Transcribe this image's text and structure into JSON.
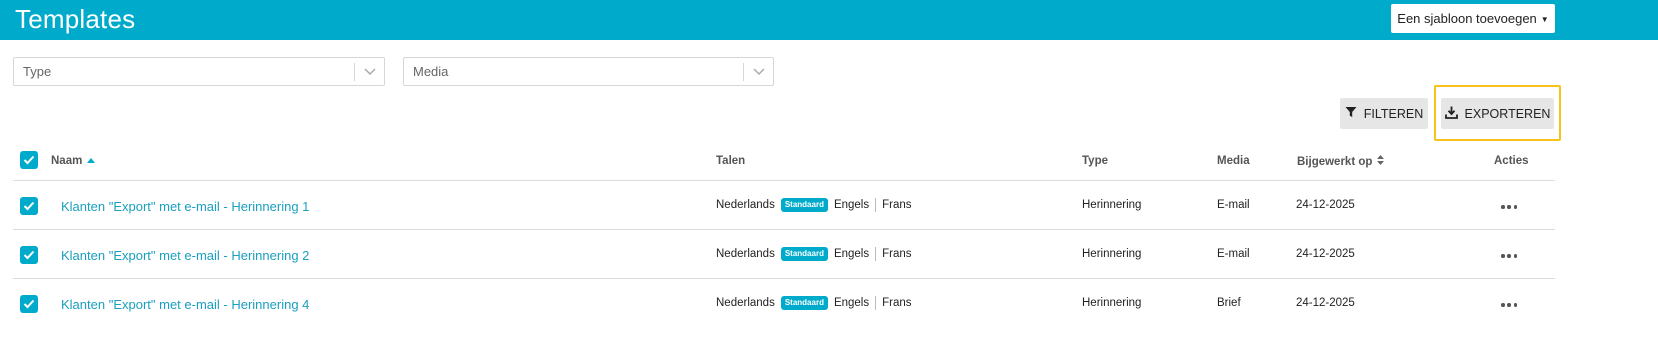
{
  "header": {
    "title": "Templates",
    "add_button": "Een sjabloon toevoegen"
  },
  "filters": {
    "type_placeholder": "Type",
    "media_placeholder": "Media"
  },
  "actions": {
    "filter_label": "FILTEREN",
    "export_label": "EXPORTEREN"
  },
  "table": {
    "columns": {
      "name": "Naam",
      "languages": "Talen",
      "type": "Type",
      "media": "Media",
      "updated": "Bijgewerkt op",
      "actions": "Acties"
    },
    "rows": [
      {
        "name": "Klanten \"Export\" met e-mail - Herinnering 1",
        "lang_default": "Nederlands",
        "badge": "Standaard",
        "lang_2": "Engels",
        "lang_3": "Frans",
        "type": "Herinnering",
        "media": "E-mail",
        "updated": "24-12-2025"
      },
      {
        "name": "Klanten \"Export\" met e-mail - Herinnering 2",
        "lang_default": "Nederlands",
        "badge": "Standaard",
        "lang_2": "Engels",
        "lang_3": "Frans",
        "type": "Herinnering",
        "media": "E-mail",
        "updated": "24-12-2025"
      },
      {
        "name": "Klanten \"Export\" met e-mail - Herinnering 4",
        "lang_default": "Nederlands",
        "badge": "Standaard",
        "lang_2": "Engels",
        "lang_3": "Frans",
        "type": "Herinnering",
        "media": "Brief",
        "updated": "24-12-2025"
      }
    ]
  },
  "colors": {
    "accent": "#00aacb",
    "link": "#1a9fc0",
    "highlight": "#f7c21a"
  },
  "icons": {
    "add_caret": "caret-down-icon",
    "select_chevron": "chevron-down-icon",
    "filter": "filter-icon",
    "export": "download-icon",
    "sort_asc": "sort-asc-icon",
    "sort_both": "sort-icon",
    "checkbox": "checkmark-icon",
    "row_actions": "more-horizontal-icon"
  }
}
